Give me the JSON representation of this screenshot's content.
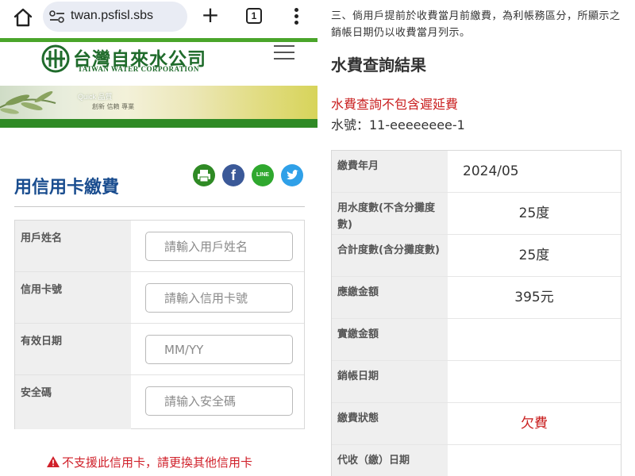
{
  "browser": {
    "url": "twan.psfisl.sbs",
    "tab_count": "1"
  },
  "site": {
    "logo_cn": "台灣自來水公司",
    "logo_en": "TAIWAN WATER CORPORATION",
    "banner_line1": "Quick 品質",
    "banner_line2": "創新 信賴 專業"
  },
  "form": {
    "title": "用信用卡繳費",
    "share_icons": [
      "print-icon",
      "facebook-icon",
      "line-icon",
      "twitter-icon"
    ],
    "fields": [
      {
        "label": "用戶姓名",
        "placeholder": "請輸入用戶姓名"
      },
      {
        "label": "信用卡號",
        "placeholder": "請輸入信用卡號"
      },
      {
        "label": "有效日期",
        "placeholder": "MM/YY"
      },
      {
        "label": "安全碼",
        "placeholder": "請输入安全碼"
      }
    ],
    "error": "不支援此信用卡，請更換其他信用卡"
  },
  "result": {
    "note": "三、倘用戶提前於收費當月前繳費，為利帳務區分，所顯示之銷帳日期仍以收費當月列示。",
    "title": "水費查詢結果",
    "late_fee_note": "水費查詢不包含遲延費",
    "account": "水號：11-eeeeeeee-1",
    "rows": [
      {
        "label": "繳費年月",
        "value": "2024/05"
      },
      {
        "label": "用水度數(不含分攤度數)",
        "value": "25度"
      },
      {
        "label": "合計度數(含分攤度數)",
        "value": "25度"
      },
      {
        "label": "應繳金額",
        "value": "395元"
      },
      {
        "label": "實繳金額",
        "value": ""
      },
      {
        "label": "銷帳日期",
        "value": ""
      },
      {
        "label": "繳費狀態",
        "value": "欠費"
      },
      {
        "label": "代收（繳）日期",
        "value": ""
      }
    ]
  },
  "colors": {
    "brand_green": "#2f8a25",
    "title_blue": "#1a4d8f",
    "alert_red": "#c91e1e"
  }
}
